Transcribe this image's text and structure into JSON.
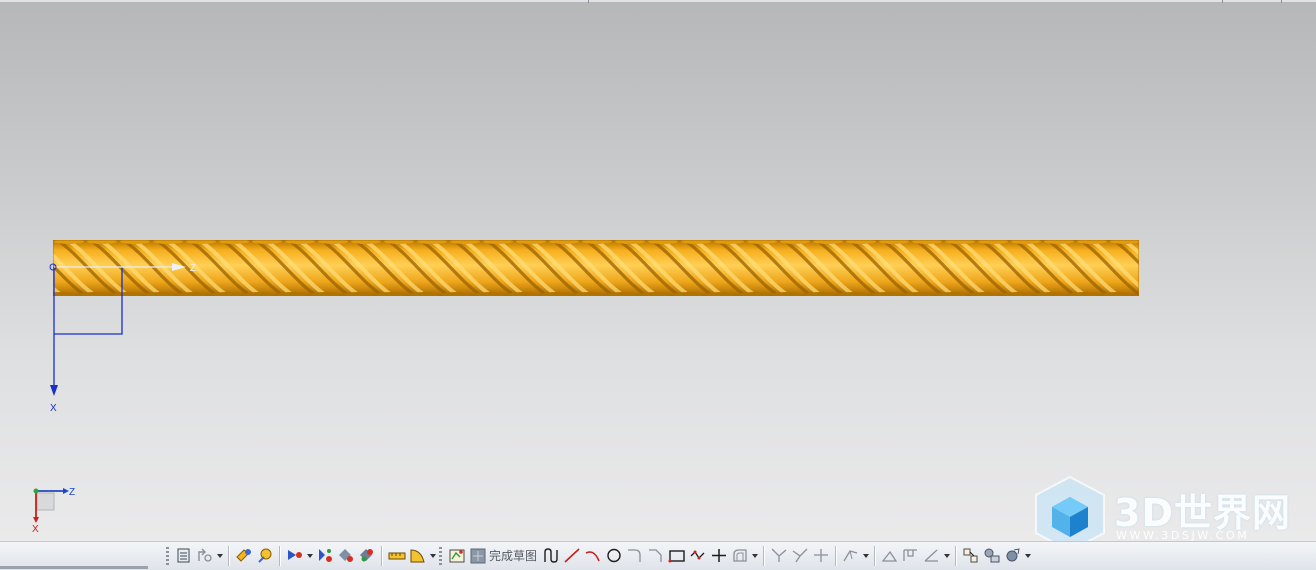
{
  "viewport": {
    "csys_labels": {
      "x": "X",
      "z": "Z"
    },
    "triad_labels": {
      "x": "X",
      "z": "Z"
    },
    "colors": {
      "rope": "#f6ae1c",
      "rope_dark": "#b87700",
      "rope_light": "#ffd35a",
      "csys": "#1a2fc8",
      "triad_x": "#c8201a",
      "triad_z": "#1f48c8"
    }
  },
  "watermark": {
    "title": "3D世界网",
    "url": "WWW.3DSJW.COM"
  },
  "toolbar": {
    "finish_sketch_label": "完成草图",
    "icons": [
      "sketch-orient-icon",
      "sketch-settings-icon",
      "snap-view-icon",
      "reattach-icon",
      "constraint-icon",
      "auto-constraint-icon",
      "show-constraints-icon",
      "measure-icon",
      "analysis-icon",
      "sketch-icon",
      "finish-sketch-icon",
      "profile-icon",
      "line-icon",
      "arc-icon",
      "circle-icon",
      "fillet-icon",
      "chamfer-icon",
      "rectangle-icon",
      "polygon-icon",
      "point-icon",
      "offset-icon",
      "quick-trim-icon",
      "quick-extend-icon",
      "corner-icon",
      "make-corner-icon",
      "mirror-icon",
      "pattern-icon",
      "derived-line-icon",
      "dimension-icon",
      "geometric-constraint-icon",
      "animate-icon"
    ]
  }
}
